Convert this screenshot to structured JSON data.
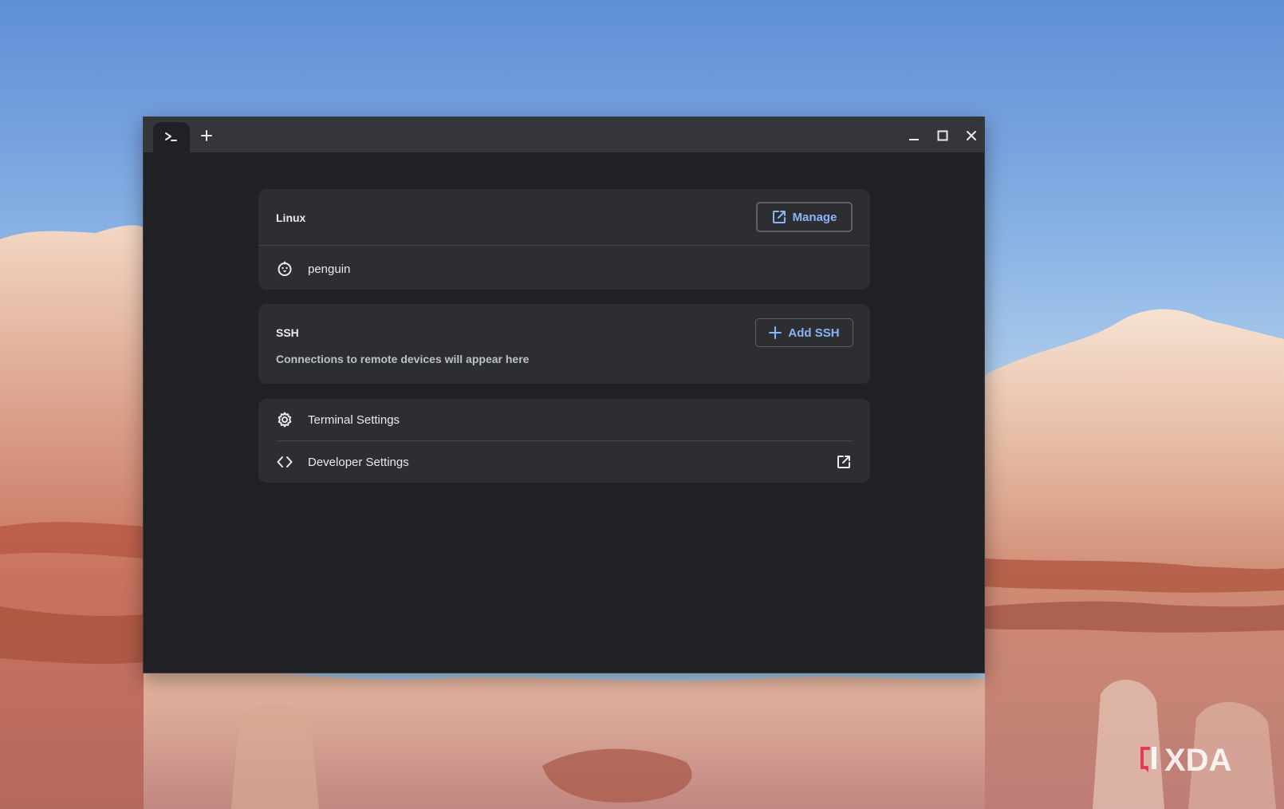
{
  "window": {
    "tab_icon": "terminal-prompt-icon",
    "new_tab_icon": "plus-icon",
    "controls": [
      "minimize-icon",
      "maximize-icon",
      "close-icon"
    ]
  },
  "linux": {
    "title": "Linux",
    "manage_label": "Manage",
    "containers": [
      {
        "name": "penguin",
        "icon": "penguin-icon"
      }
    ]
  },
  "ssh": {
    "title": "SSH",
    "add_label": "Add SSH",
    "empty_message": "Connections to remote devices will appear here"
  },
  "settings": {
    "terminal_label": "Terminal Settings",
    "developer_label": "Developer Settings"
  },
  "colors": {
    "accent": "#8ab4f8",
    "window_bg": "#202124",
    "card_bg": "#2d2e31",
    "titlebar_bg": "#35363a"
  }
}
